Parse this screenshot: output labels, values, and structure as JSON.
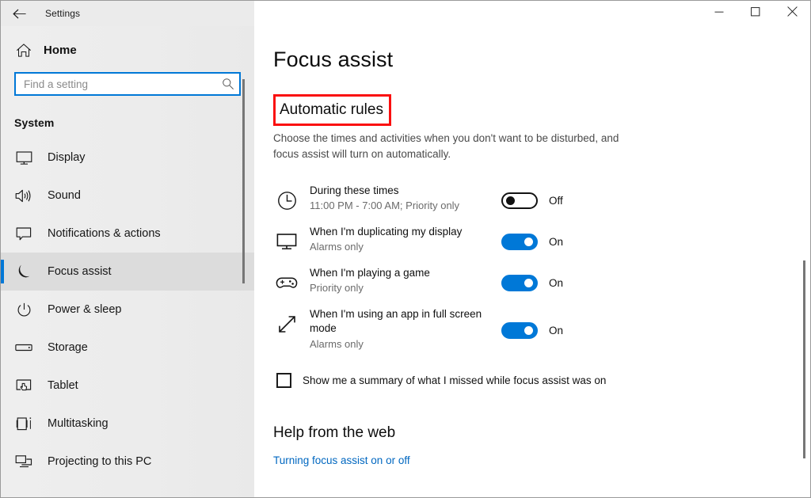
{
  "window": {
    "title": "Settings",
    "back_icon": "back-arrow-icon",
    "controls": {
      "minimize": "minimize-icon",
      "maximize": "maximize-icon",
      "close": "close-icon"
    }
  },
  "sidebar": {
    "home": {
      "label": "Home",
      "icon": "home-icon"
    },
    "search": {
      "placeholder": "Find a setting",
      "value": "",
      "icon": "search-icon"
    },
    "section_label": "System",
    "items": [
      {
        "label": "Display",
        "icon": "monitor-icon",
        "selected": false
      },
      {
        "label": "Sound",
        "icon": "speaker-icon",
        "selected": false
      },
      {
        "label": "Notifications & actions",
        "icon": "notification-balloon-icon",
        "selected": false
      },
      {
        "label": "Focus assist",
        "icon": "moon-icon",
        "selected": true
      },
      {
        "label": "Power & sleep",
        "icon": "power-icon",
        "selected": false
      },
      {
        "label": "Storage",
        "icon": "drive-icon",
        "selected": false
      },
      {
        "label": "Tablet",
        "icon": "tablet-hand-icon",
        "selected": false
      },
      {
        "label": "Multitasking",
        "icon": "multitasking-icon",
        "selected": false
      },
      {
        "label": "Projecting to this PC",
        "icon": "projecting-icon",
        "selected": false
      }
    ]
  },
  "main": {
    "page_title": "Focus assist",
    "section": {
      "heading": "Automatic rules",
      "highlight_color": "#fa0f0f",
      "description": "Choose the times and activities when you don't want to be disturbed, and focus assist will turn on automatically."
    },
    "rules": [
      {
        "icon": "clock-icon",
        "title": "During these times",
        "subtitle": "11:00 PM - 7:00 AM; Priority only",
        "state": "off",
        "state_label": "Off"
      },
      {
        "icon": "monitor-icon",
        "title": "When I'm duplicating my display",
        "subtitle": "Alarms only",
        "state": "on",
        "state_label": "On"
      },
      {
        "icon": "gamepad-icon",
        "title": "When I'm playing a game",
        "subtitle": "Priority only",
        "state": "on",
        "state_label": "On"
      },
      {
        "icon": "fullscreen-arrows-icon",
        "title": "When I'm using an app in full screen mode",
        "subtitle": "Alarms only",
        "state": "on",
        "state_label": "On"
      }
    ],
    "summary_checkbox": {
      "label": "Show me a summary of what I missed while focus assist was on",
      "checked": false
    },
    "help": {
      "heading": "Help from the web",
      "link": "Turning focus assist on or off",
      "link_color": "#0067c0"
    }
  },
  "theme": {
    "accent": "#0078d7",
    "sidebar_bg": "#ececec",
    "content_bg": "#ffffff"
  }
}
